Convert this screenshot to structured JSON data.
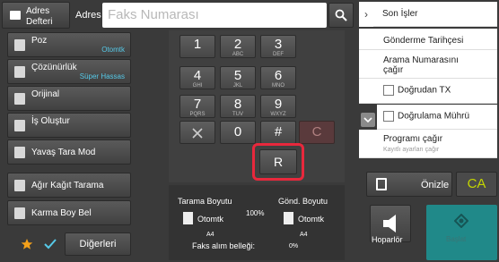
{
  "address_book": {
    "line1": "Adres",
    "line2": "Defteri"
  },
  "address_label": "Adres",
  "fax_placeholder": "Faks Numarası",
  "left_menu": [
    {
      "label": "Poz",
      "value": "Otomtk"
    },
    {
      "label": "Çözünürlük",
      "value": "Süper Hassas"
    },
    {
      "label": "Orijinal",
      "value": ""
    },
    {
      "label": "İş Oluştur",
      "value": ""
    },
    {
      "label": "Yavaş Tara Mod",
      "value": ""
    },
    {
      "label": "Ağır Kağıt Tarama",
      "value": ""
    },
    {
      "label": "Karma Boy Bel",
      "value": ""
    }
  ],
  "others_label": "Diğerleri",
  "keypad": [
    {
      "digit": "1",
      "letters": ""
    },
    {
      "digit": "2",
      "letters": "ABC"
    },
    {
      "digit": "3",
      "letters": "DEF"
    },
    {
      "digit": "4",
      "letters": "GHI"
    },
    {
      "digit": "5",
      "letters": "JKL"
    },
    {
      "digit": "6",
      "letters": "MNO"
    },
    {
      "digit": "7",
      "letters": "PQRS"
    },
    {
      "digit": "8",
      "letters": "TUV"
    },
    {
      "digit": "9",
      "letters": "WXYZ"
    },
    {
      "digit": "0",
      "letters": ""
    },
    {
      "digit": "#",
      "letters": ""
    }
  ],
  "clear_key": "C",
  "r_key": "R",
  "scan": {
    "size_label": "Tarama Boyutu",
    "size_value": "Otomtk",
    "paper": "A4",
    "ratio": "100%",
    "send_label": "Gönd. Boyutu",
    "send_value": "Otomtk",
    "send_paper": "A4"
  },
  "memory": {
    "label": "Faks alım belleği:",
    "value": "0%"
  },
  "right_menu": {
    "recent": "Son İşler",
    "history": "Gönderme Tarihçesi",
    "search_line1": "Arama Numarasını",
    "search_line2": "çağır",
    "direct_tx": "Doğrudan TX",
    "verify_stamp": "Doğrulama Mührü",
    "program": "Programı çağır",
    "program_sub": "Kayıtlı ayarları çağır"
  },
  "preview_label": "Önizle",
  "ca_label": "CA",
  "speaker_label": "Hoparlör",
  "start_label": "Başlat",
  "colors": {
    "accent_blue": "#56c9e8",
    "highlight_red": "#e8283c",
    "start_teal": "#18a4a4",
    "ca_green": "#c4d600",
    "star": "#f4a11a"
  }
}
